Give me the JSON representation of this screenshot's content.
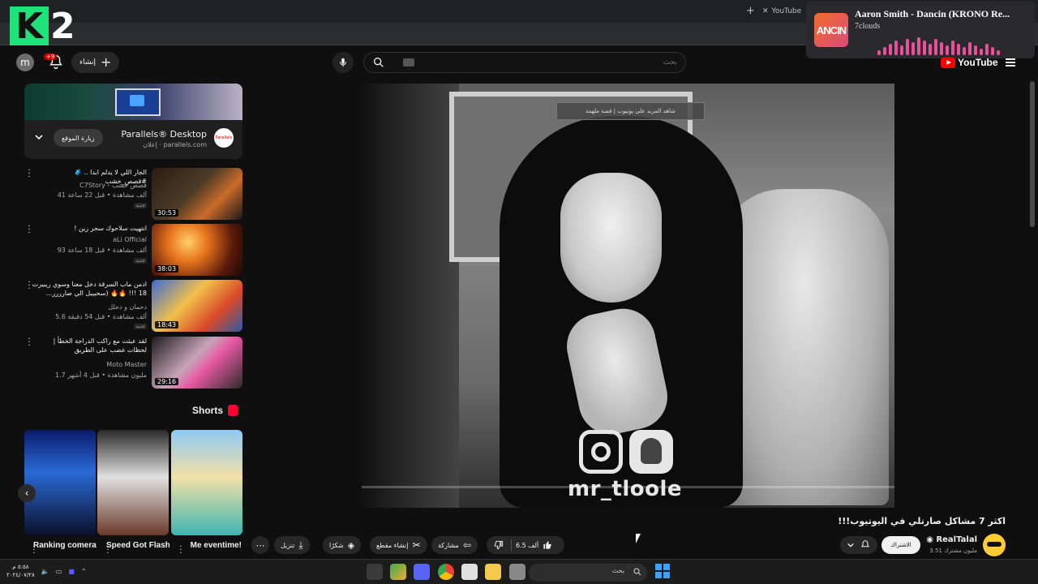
{
  "browser": {
    "tab_title": "YouTube",
    "logo_letter": "K",
    "logo_number": "2"
  },
  "now_playing": {
    "title": "Aaron Smith - Dancin (KRONO Re...",
    "artist": "7clouds",
    "art_text": "ANCIN"
  },
  "header": {
    "avatar_letter": "m",
    "notification_count": "+9",
    "create_label": "إنشاء",
    "search_placeholder": "بحث",
    "logo_text": "YouTube"
  },
  "ad": {
    "title": "Parallels® Desktop",
    "domain": "parallels.com",
    "sponsored": "إعلان",
    "visit_label": "زيارة الموقع",
    "logo_text": "Parallels"
  },
  "related": [
    {
      "title": "الجار اللي لا يدلم ابدا .. 🧳 #قصص_خشب",
      "channel": "C7Story - قصص خشب",
      "meta": "41 ألف مشاهدة • قبل 22 ساعة",
      "badge": "جديد",
      "duration": "30:53"
    },
    {
      "title": "انتهيت سلاحوك سحر زين !",
      "channel": "aLi Official",
      "meta": "93 ألف مشاهدة • قبل 18 ساعة",
      "badge": "جديد",
      "duration": "38:03"
    },
    {
      "title": "ادمن ماب السرقة دخل معنا وسوي ريبيرت 18 !!! 🔥🔥 (سحبيبل الي صارررر...",
      "channel": "دحمان و دحلل",
      "meta": "5.6 ألف مشاهدة • قبل 54 دقيقة",
      "badge": "جديد",
      "duration": "18:43"
    },
    {
      "title": "لقد عبثت مع راكب الدراجة الخطأ | لحظات غضب على الطريق",
      "channel": "Moto Master",
      "meta": "1.7 مليون مشاهدة • قبل 4 أشهر",
      "badge": "",
      "duration": "29:16"
    }
  ],
  "shorts": {
    "heading": "Shorts",
    "items": [
      {
        "title": "Me eventime!"
      },
      {
        "title": "Speed Got Flashbacks"
      },
      {
        "title": "Ranking comeratio"
      }
    ]
  },
  "video": {
    "caption": "شاهد المزيد على يوتيوب | قصة ملهمة",
    "watermark": "mr_tloole",
    "title": "اكثر 7 مشاكل صارتلي في اليوتيوب!!!",
    "channel": "RealTalal",
    "subscribers": "3.51 مليون مشترك",
    "subscribe_label": "الاشتراك",
    "likes": "6.5 ألف",
    "share_label": "مشاركة",
    "clip_label": "إنشاء مقطع",
    "thanks_label": "شكرًا",
    "download_label": "تنزيل",
    "progress": 0.0
  },
  "taskbar": {
    "search_label": "بحث",
    "time": "٥:٥٨ م",
    "date": "٢٠٢٤/٠٧/٢٨"
  },
  "colors": {
    "accent": "#ff0000",
    "background": "#0f0f0f",
    "surface": "#272727",
    "k2_green": "#1ee37a"
  }
}
